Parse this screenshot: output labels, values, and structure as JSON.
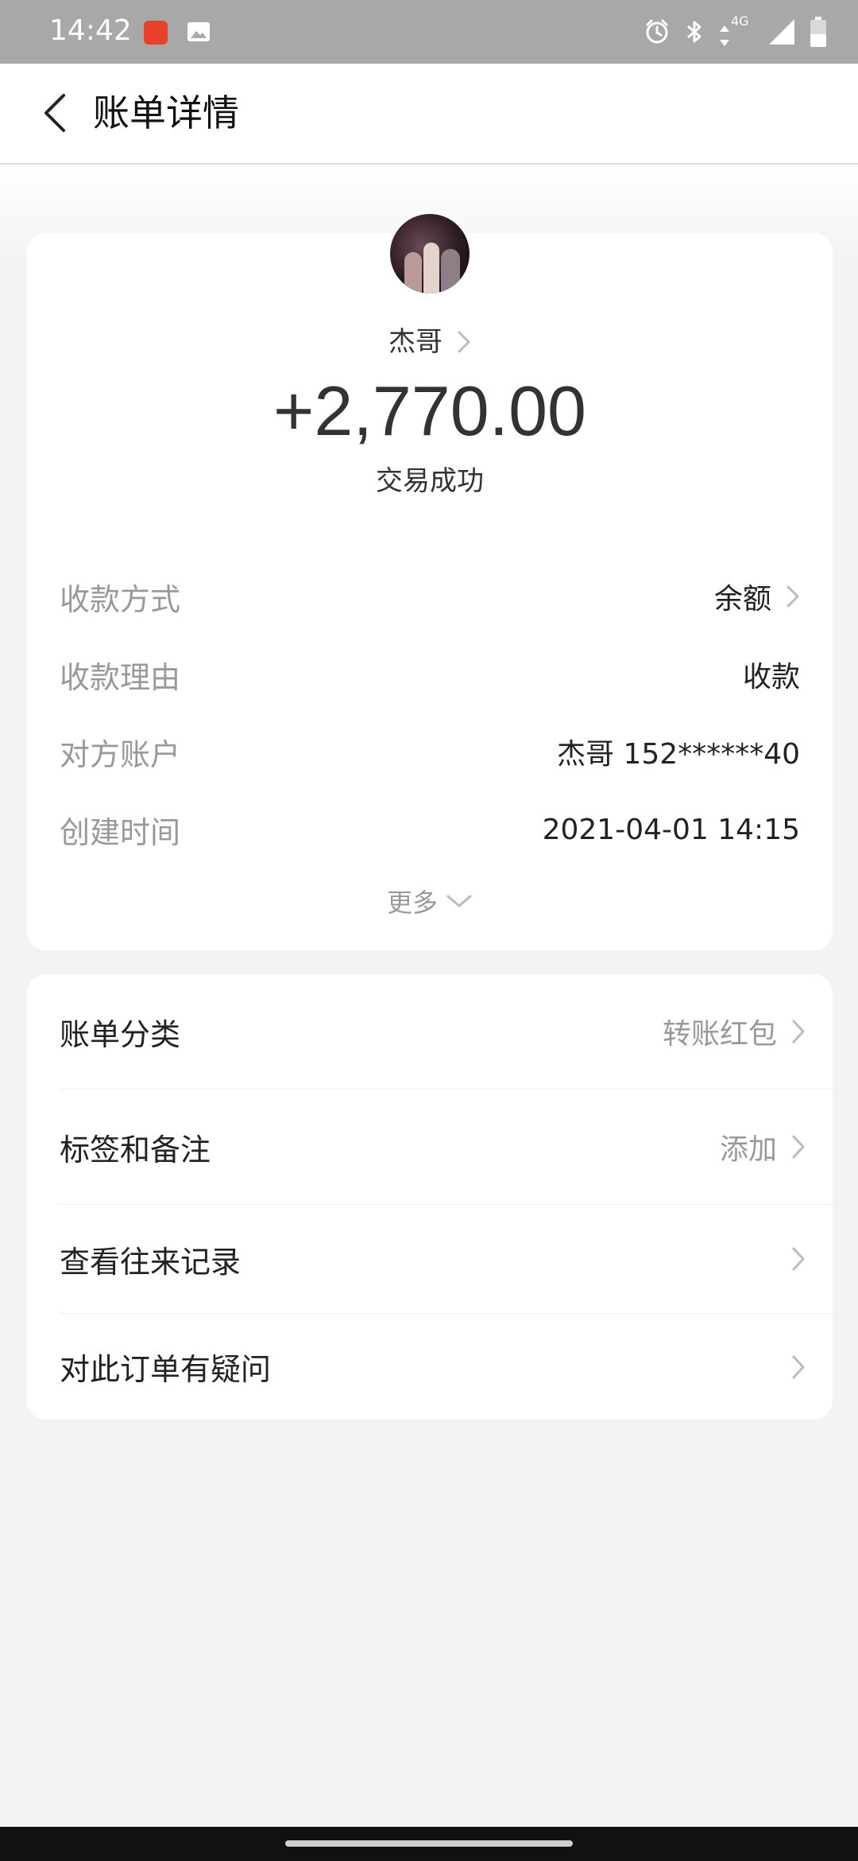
{
  "status_bar": {
    "time": "14:42",
    "network": "4G",
    "icons": [
      "app-icon",
      "image-icon",
      "alarm-icon",
      "bluetooth-icon",
      "data-arrows-icon",
      "signal-icon",
      "battery-icon"
    ]
  },
  "header": {
    "title": "账单详情",
    "back_icon": "chevron-left-icon"
  },
  "bill": {
    "payee": "杰哥",
    "amount": "+2,770.00",
    "status": "交易成功"
  },
  "details": [
    {
      "label": "收款方式",
      "value": "余额",
      "has_arrow": true
    },
    {
      "label": "收款理由",
      "value": "收款",
      "has_arrow": false
    },
    {
      "label": "对方账户",
      "value": "杰哥 152******40",
      "has_arrow": false
    },
    {
      "label": "创建时间",
      "value": "2021-04-01 14:15",
      "has_arrow": false
    }
  ],
  "more": {
    "label": "更多"
  },
  "list": [
    {
      "label": "账单分类",
      "value": "转账红包"
    },
    {
      "label": "标签和备注",
      "value": "添加"
    },
    {
      "label": "查看往来记录",
      "value": ""
    },
    {
      "label": "对此订单有疑问",
      "value": ""
    }
  ],
  "colors": {
    "background": "#f3f3f3",
    "card": "#ffffff",
    "status_bar": "#a8a8a8",
    "secondary_text": "#999999",
    "primary_text": "#222222"
  }
}
